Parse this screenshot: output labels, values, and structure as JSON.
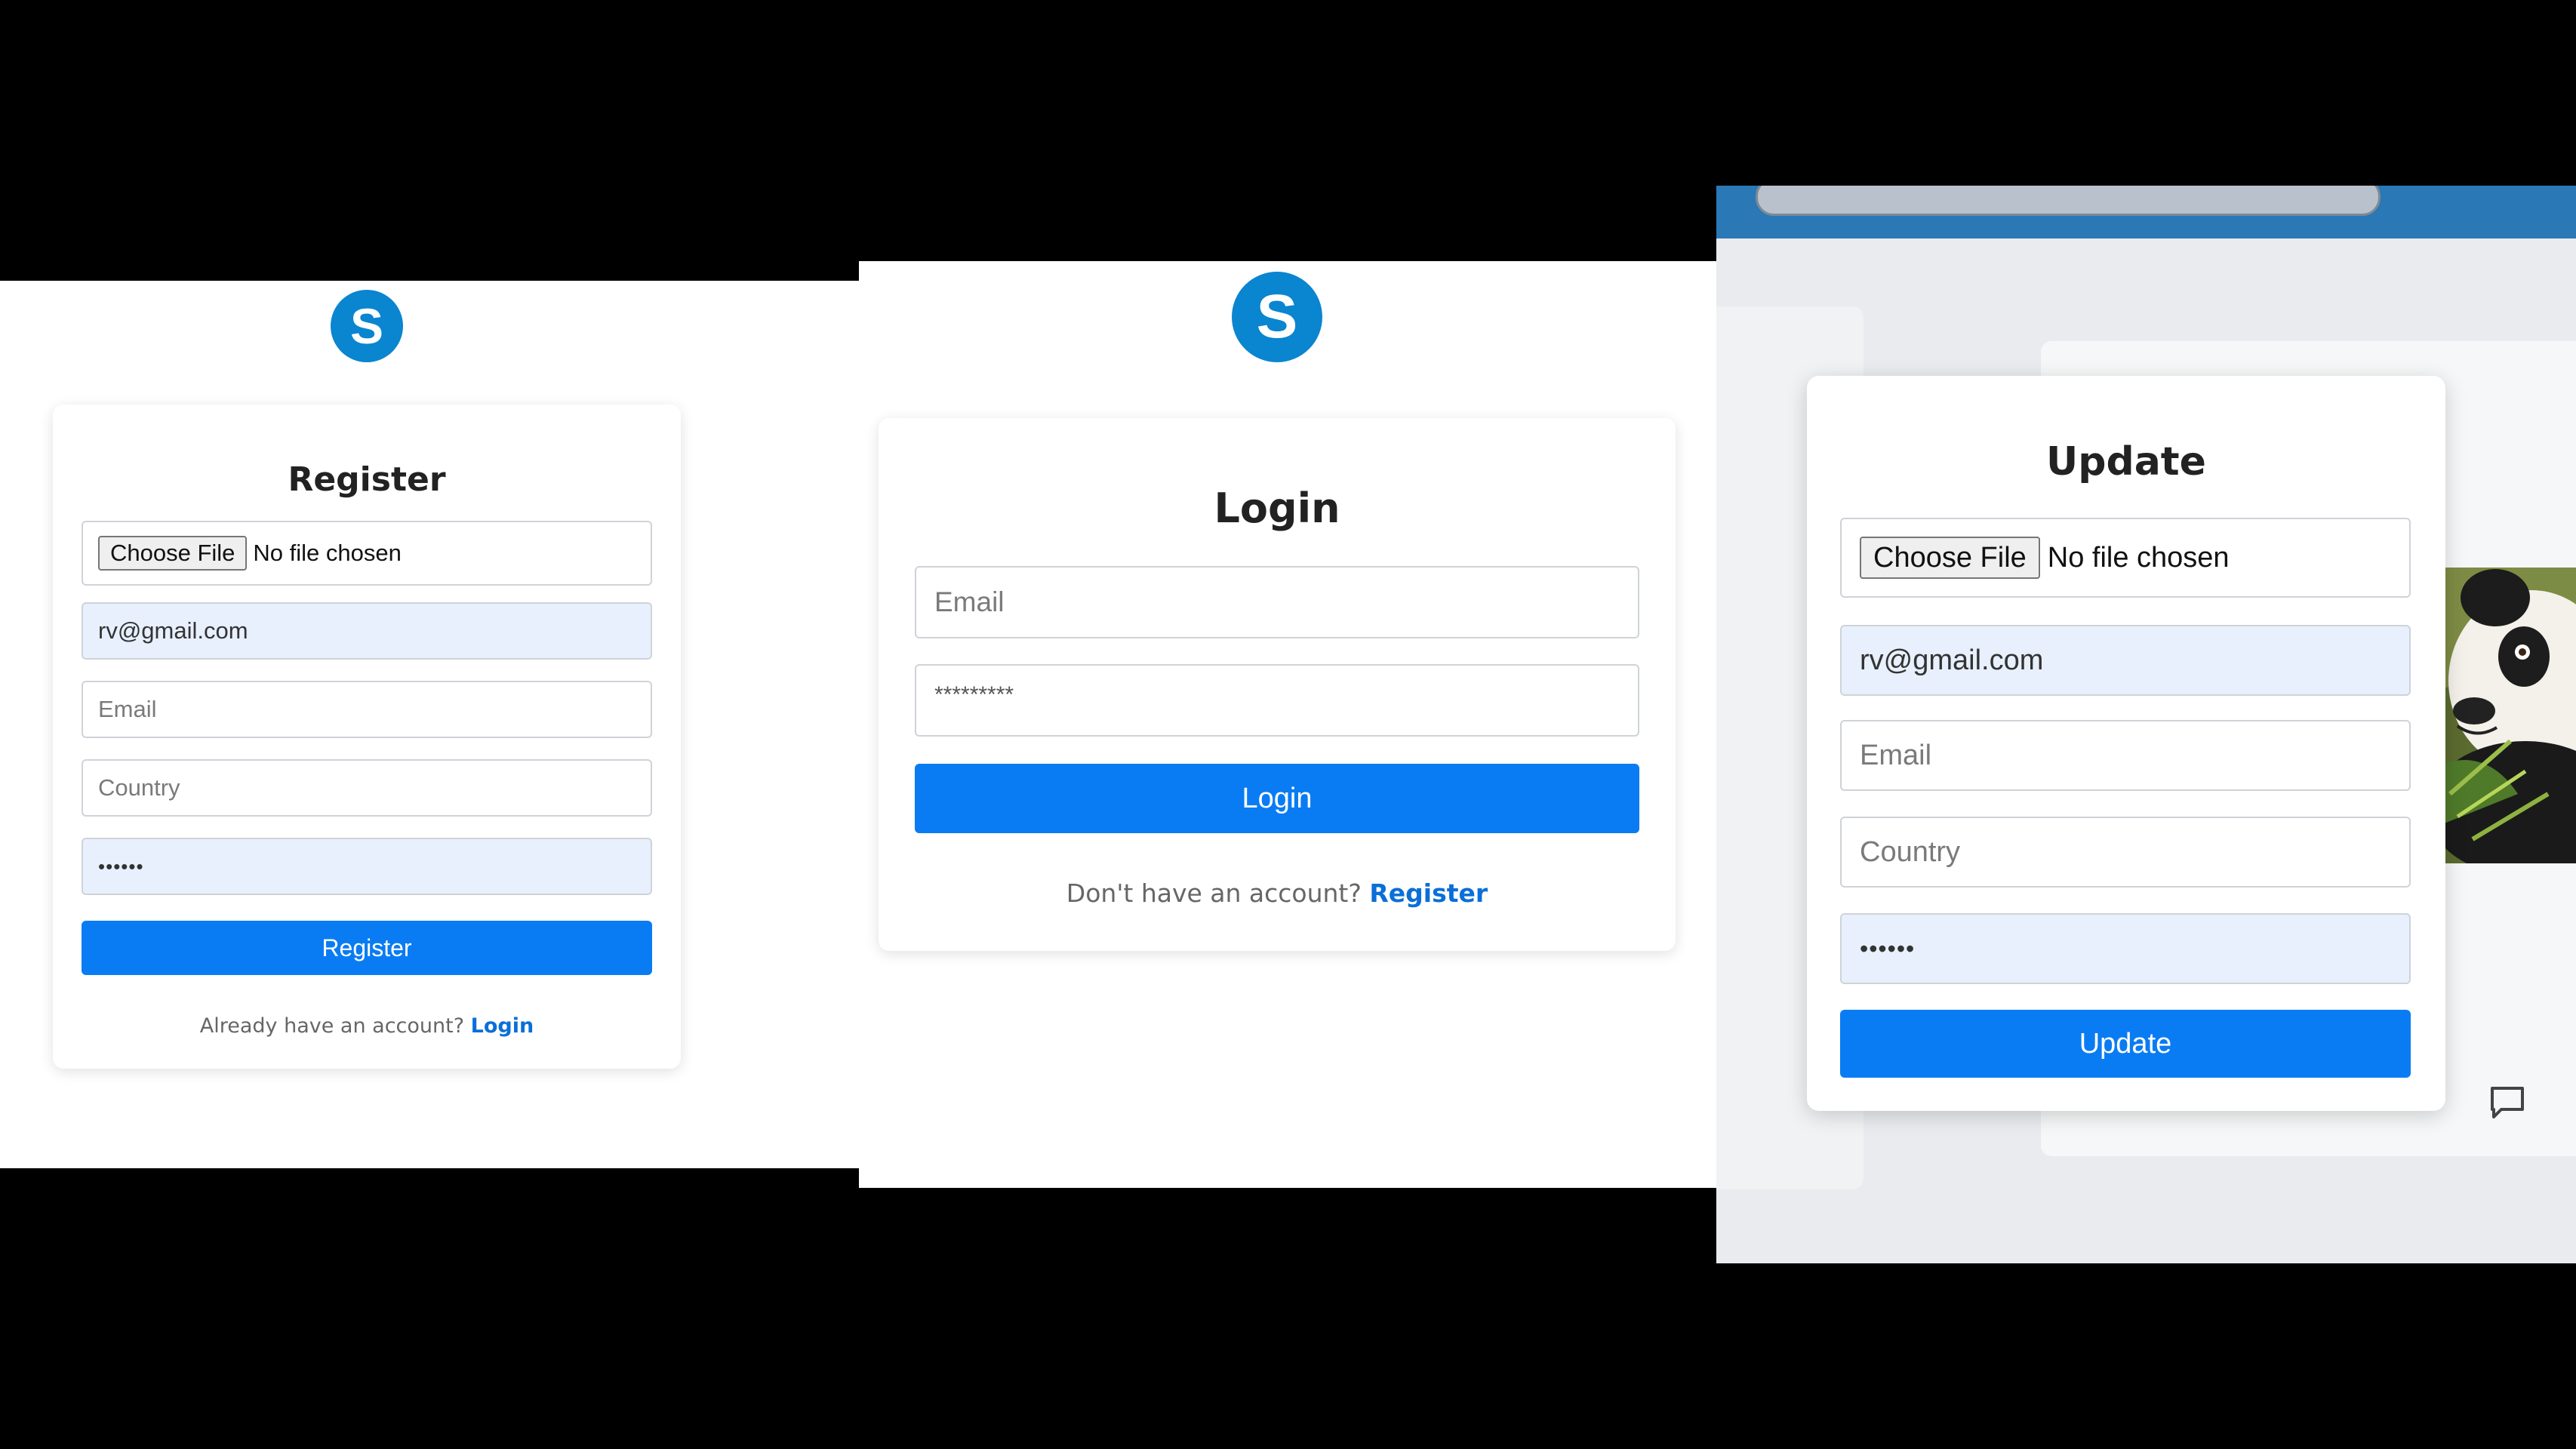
{
  "register": {
    "logo_letter": "S",
    "title": "Register",
    "file_button": "Choose File",
    "file_status": "No file chosen",
    "name_value": "rv@gmail.com",
    "email_placeholder": "Email",
    "country_placeholder": "Country",
    "password_value": "••••••",
    "submit_label": "Register",
    "footer_text": "Already have an account?",
    "footer_link": "Login"
  },
  "login": {
    "logo_letter": "S",
    "title": "Login",
    "email_placeholder": "Email",
    "password_value": "*********",
    "submit_label": "Login",
    "footer_text": "Don't have an account?",
    "footer_link": "Register"
  },
  "update": {
    "title": "Update",
    "file_button": "Choose File",
    "file_status": "No file chosen",
    "name_value": "rv@gmail.com",
    "email_placeholder": "Email",
    "country_placeholder": "Country",
    "password_value": "••••••",
    "submit_label": "Update"
  },
  "colors": {
    "primary_button": "#0a7cf3",
    "logo": "#0a85d0",
    "autofill_field": "#e8f0fe",
    "link": "#0a6fd8"
  },
  "icons": {
    "logo": "letter-s-circle",
    "comment": "speech-bubble"
  }
}
